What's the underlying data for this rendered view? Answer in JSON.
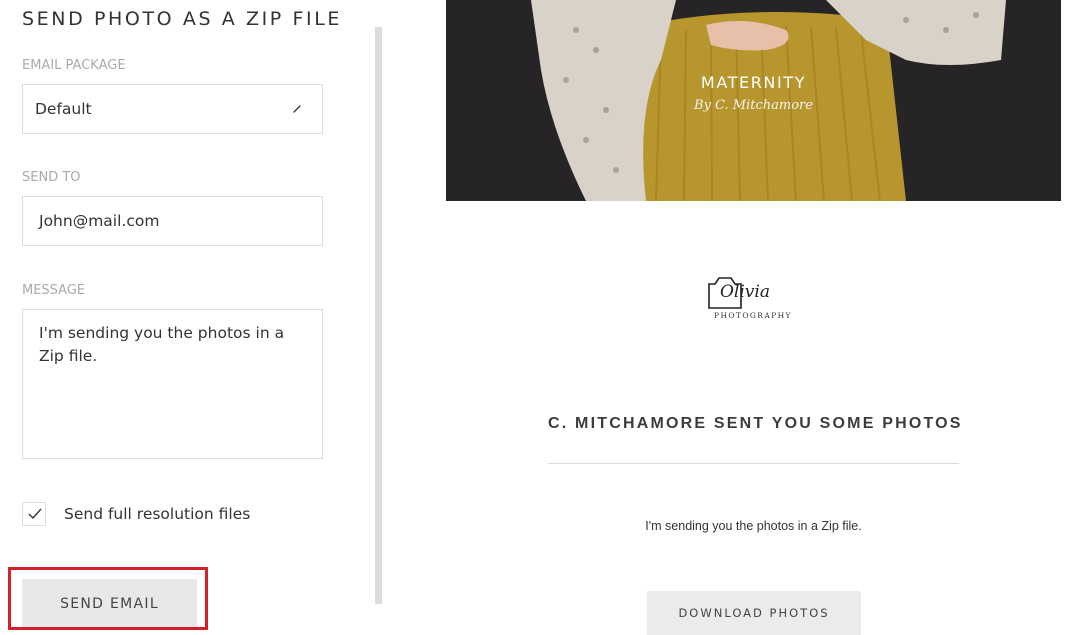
{
  "form": {
    "title": "SEND PHOTO AS A ZIP FILE",
    "email_package": {
      "label": "EMAIL PACKAGE",
      "value": "Default"
    },
    "send_to": {
      "label": "SEND TO",
      "value": "John@mail.com"
    },
    "message": {
      "label": "MESSAGE",
      "value": "I'm sending you the photos in a Zip file."
    },
    "full_resolution": {
      "label": "Send full resolution files",
      "checked": true
    },
    "send_button": "SEND EMAIL"
  },
  "preview": {
    "hero": {
      "title": "MATERNITY",
      "subtitle": "By C. Mitchamore"
    },
    "logo": {
      "script": "Olivia",
      "sub": "PHOTOGRAPHY"
    },
    "headline": "C. MITCHAMORE SENT YOU SOME PHOTOS",
    "message": "I'm sending you the photos in a Zip file.",
    "download_button": "DOWNLOAD PHOTOS"
  },
  "colors": {
    "highlight": "#d4202b",
    "button_bg": "#e8e8e8",
    "hero_bg": "#262426",
    "skirt": "#b8962e",
    "sweater": "#d8d2c8"
  },
  "icons": {
    "select": "pencil-icon",
    "checkbox": "checkmark-icon",
    "logo": "camera-icon"
  }
}
